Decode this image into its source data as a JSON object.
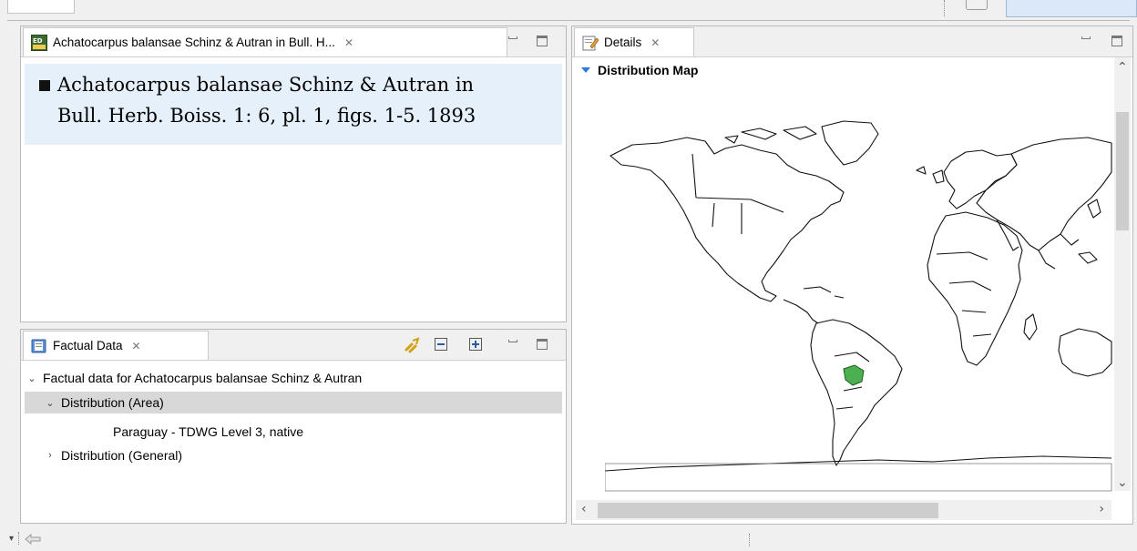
{
  "name_panel": {
    "tab_title": "Achatocarpus balansae Schinz & Autran in Bull. H...",
    "tab_icon": "editor-icon",
    "name_line1": "Achatocarpus balansae Schinz & Autran in",
    "name_line2": "Bull. Herb. Boiss. 1: 6, pl. 1, figs. 1-5. 1893"
  },
  "factual_panel": {
    "tab_title": "Factual Data",
    "tab_icon": "factual-data-icon",
    "tree": {
      "root": "Factual data for Achatocarpus balansae Schinz & Autran",
      "distribution_area": "Distribution (Area)",
      "area_child": "Paraguay - TDWG Level 3, native",
      "distribution_general": "Distribution (General)"
    }
  },
  "details_panel": {
    "tab_title": "Details",
    "tab_icon": "details-edit-icon",
    "section_title": "Distribution Map",
    "highlight_color": "#4caf50"
  },
  "tab_close_glyph": "✕",
  "colors": {
    "selection": "#e5f0fb",
    "tree_selection": "#d8d8d8",
    "accent": "#2a7ad8"
  }
}
